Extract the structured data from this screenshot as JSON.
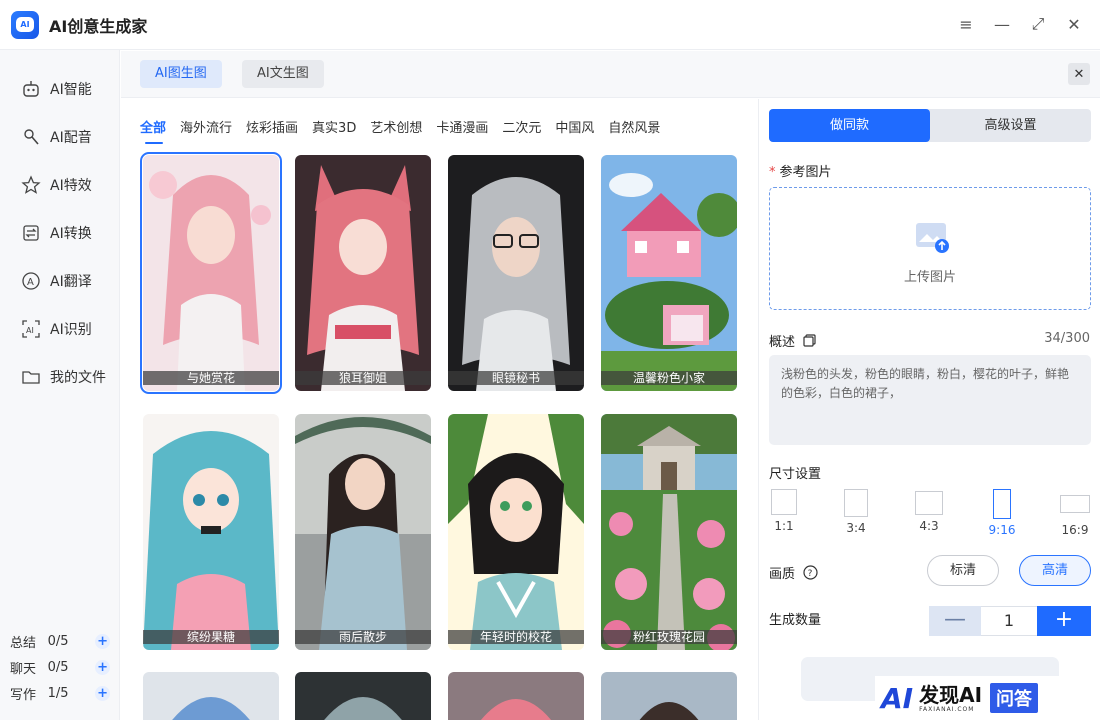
{
  "app": {
    "title": "AI创意生成家",
    "logo_text": "AI"
  },
  "window_controls": {
    "menu": "≡",
    "minimize": "—",
    "maximize": "⤢",
    "close": "✕"
  },
  "sidebar": {
    "items": [
      {
        "label": "AI智能",
        "icon": "robot-icon"
      },
      {
        "label": "AI配音",
        "icon": "microphone-icon"
      },
      {
        "label": "AI特效",
        "icon": "star-icon"
      },
      {
        "label": "AI转换",
        "icon": "convert-icon"
      },
      {
        "label": "AI翻译",
        "icon": "translate-icon"
      },
      {
        "label": "AI识别",
        "icon": "scan-icon"
      },
      {
        "label": "我的文件",
        "icon": "folder-icon"
      }
    ],
    "quotas": [
      {
        "name": "总结",
        "value": "0/5"
      },
      {
        "name": "聊天",
        "value": "0/5"
      },
      {
        "name": "写作",
        "value": "1/5"
      }
    ]
  },
  "mode_tabs": {
    "image_to_image": "AI图生图",
    "text_to_image": "AI文生图",
    "close": "✕"
  },
  "gallery": {
    "categories": [
      "全部",
      "海外流行",
      "炫彩插画",
      "真实3D",
      "艺术创想",
      "卡通漫画",
      "二次元",
      "中国风",
      "自然风景"
    ],
    "cards": [
      {
        "caption": "与她赏花"
      },
      {
        "caption": "狼耳御姐"
      },
      {
        "caption": "眼镜秘书"
      },
      {
        "caption": "温馨粉色小家"
      },
      {
        "caption": "缤纷果糖"
      },
      {
        "caption": "雨后散步"
      },
      {
        "caption": "年轻时的校花"
      },
      {
        "caption": "粉红玫瑰花园"
      }
    ]
  },
  "panel": {
    "tab_same": "做同款",
    "tab_advanced": "高级设置",
    "reference_label": "参考图片",
    "required_mark": "*",
    "upload_text": "上传图片",
    "desc_label": "概述",
    "desc_counter": "34/300",
    "desc_value": "浅粉色的头发，粉色的眼睛，粉白，樱花的叶子，鲜艳的色彩，白色的裙子，",
    "size_label": "尺寸设置",
    "ratios": [
      "1:1",
      "3:4",
      "4:3",
      "9:16",
      "16:9"
    ],
    "selected_ratio": "9:16",
    "quality_label": "画质",
    "quality_standard": "标清",
    "quality_high": "高清",
    "count_label": "生成数量",
    "count_minus": "—",
    "count_value": "1",
    "count_plus": "+"
  },
  "watermark": {
    "ai": "AI",
    "brand": "发现AI",
    "url": "FAXIANAI.COM",
    "badge": "问答"
  },
  "colors": {
    "accent": "#1f6bff",
    "accent_light": "#dfe9fb",
    "sidebar_bg": "#f7f8fa"
  }
}
